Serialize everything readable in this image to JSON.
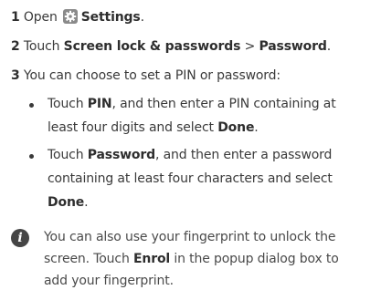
{
  "steps": {
    "s1": {
      "num": "1",
      "text": "Open",
      "bold": "Settings",
      "end": "."
    },
    "s2": {
      "num": "2",
      "pre": "Touch",
      "bold1": "Screen lock & passwords",
      "sep": ">",
      "bold2": "Password",
      "end": "."
    },
    "s3": {
      "num": "3",
      "text": "You can choose to set a PIN or password:"
    }
  },
  "bullets": {
    "b1": {
      "pre": "Touch",
      "bold": "PIN",
      "line1": ", and then enter a PIN containing at",
      "line2a": "least four digits and select",
      "bold2": "Done",
      "end": "."
    },
    "b2": {
      "pre": "Touch",
      "bold": "Password",
      "line1": ", and then enter a password",
      "line2": "containing at least four characters and select",
      "bold3": "Done",
      "end": "."
    }
  },
  "note": {
    "line1": "You can also use your fingerprint to unlock the",
    "line2a": "screen. Touch",
    "bold": "Enrol",
    "line2b": "in the popup dialog box to",
    "line3": "add your fingerprint."
  },
  "icons": {
    "settings": "settings-gear-icon",
    "info": "info-icon"
  },
  "colors": {
    "text": "#3a3a3a",
    "icon_bg": "#454545"
  }
}
